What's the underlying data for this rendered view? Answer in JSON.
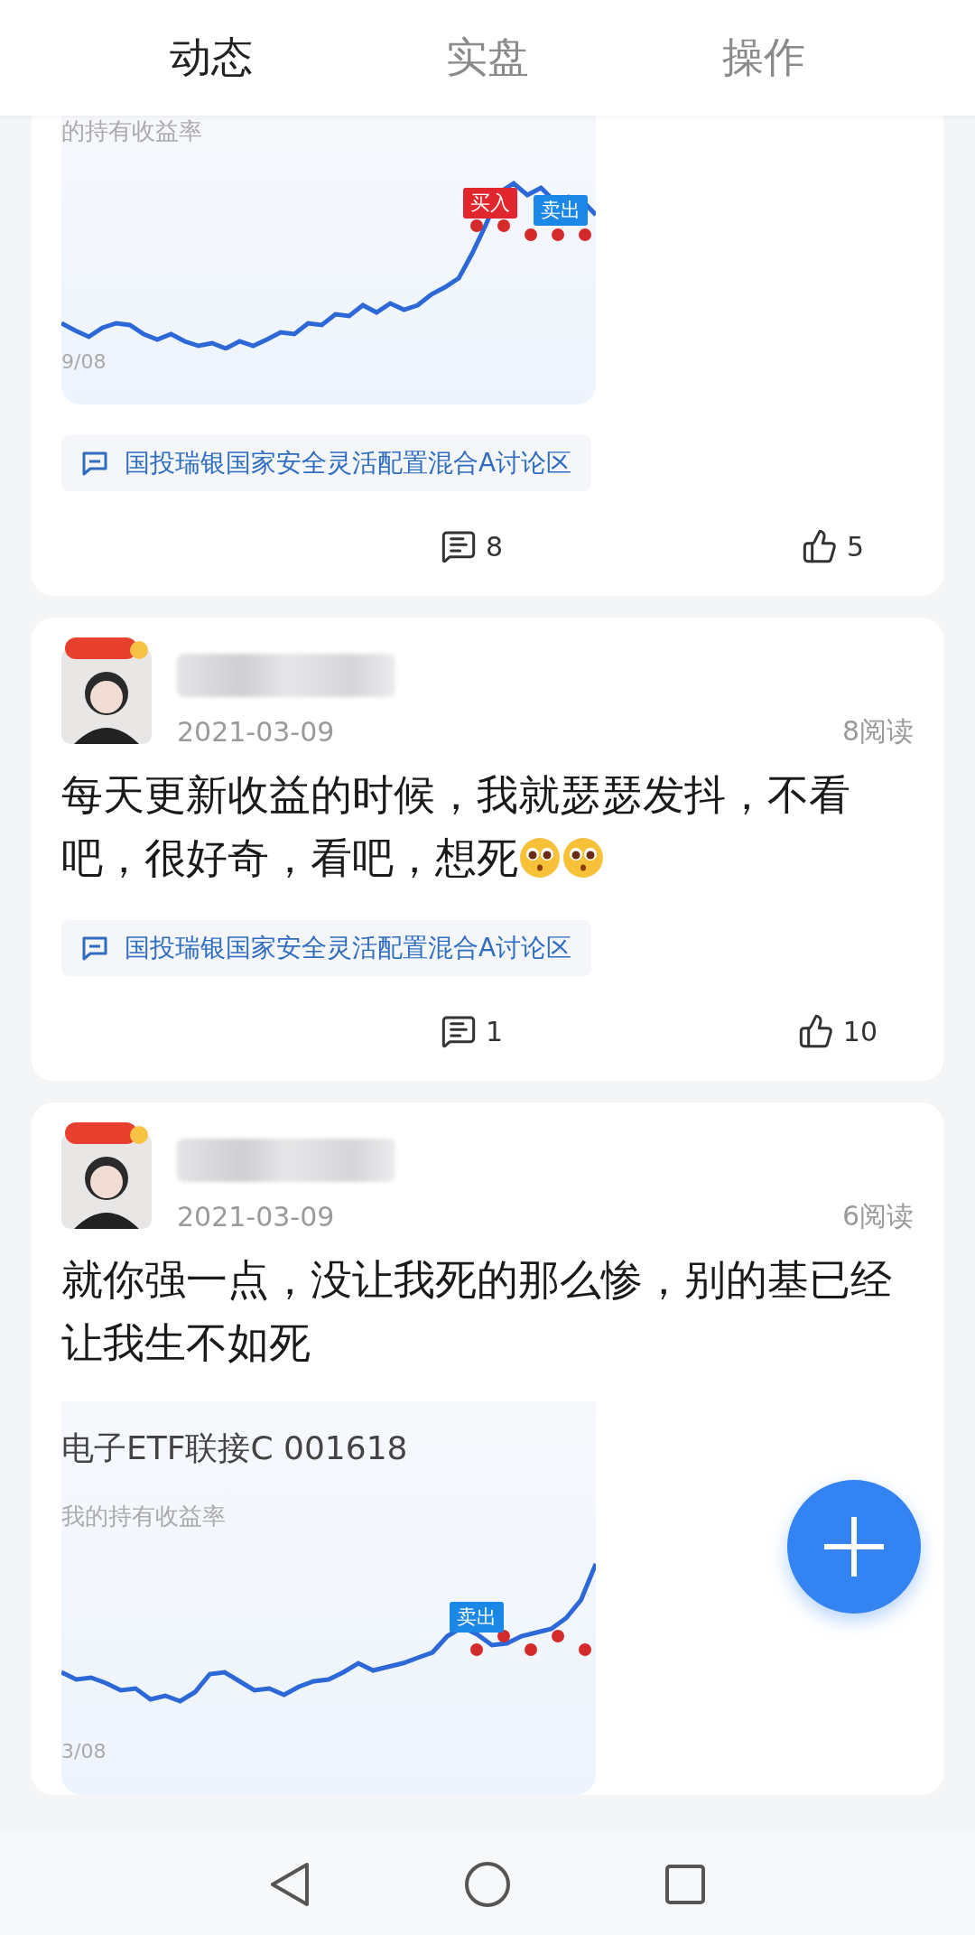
{
  "tabs": [
    {
      "label": "动态",
      "selected": true
    },
    {
      "label": "实盘",
      "selected": false
    },
    {
      "label": "操作",
      "selected": false
    }
  ],
  "posts": [
    {
      "chart": {
        "subtitle": "的持有收益率",
        "date_label": "9/08",
        "markers": [
          {
            "label": "买入",
            "kind": "buy"
          },
          {
            "label": "卖出",
            "kind": "sell"
          }
        ]
      },
      "topic": "国投瑞银国家安全灵活配置混合A讨论区",
      "comments": "8",
      "likes": "5"
    },
    {
      "author": {
        "kind": "blurred"
      },
      "date": "2021-03-09",
      "reads": "8阅读",
      "text": "每天更新收益的时候，我就瑟瑟发抖，不看吧，很好奇，看吧，想死",
      "emojis": [
        {
          "kind": "pleading"
        },
        {
          "kind": "pleading"
        }
      ],
      "topic": "国投瑞银国家安全灵活配置混合A讨论区",
      "comments": "1",
      "likes": "10"
    },
    {
      "author": {
        "kind": "blurred"
      },
      "date": "2021-03-09",
      "reads": "6阅读",
      "text": "就你强一点，没让我死的那么惨，别的基已经让我生不如死",
      "chart": {
        "title": "电子ETF联接C 001618",
        "subtitle": "我的持有收益率",
        "date_label": "3/08",
        "markers": [
          {
            "label": "卖出",
            "kind": "sell"
          }
        ]
      }
    }
  ]
}
